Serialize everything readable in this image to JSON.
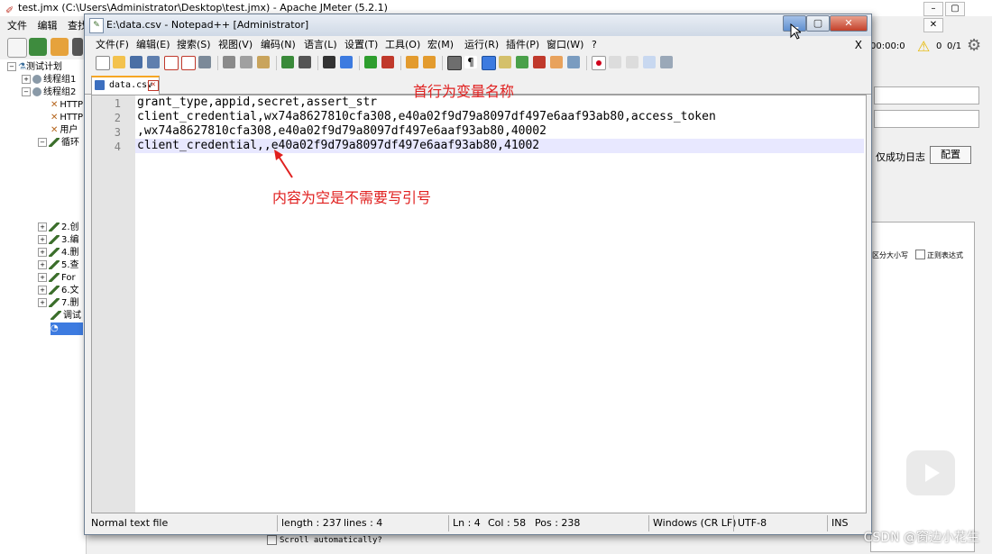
{
  "jmeter": {
    "title": "test.jmx (C:\\Users\\Administrator\\Desktop\\test.jmx) - Apache JMeter (5.2.1)",
    "menu": [
      "文件",
      "编辑",
      "查找"
    ],
    "tree": [
      {
        "label": "测试计划"
      },
      {
        "label": "线程组1"
      },
      {
        "label": "线程组2"
      },
      {
        "label": "HTTP"
      },
      {
        "label": "HTTP"
      },
      {
        "label": "用户"
      },
      {
        "label": "循环"
      },
      {
        "label": "2.创"
      },
      {
        "label": "3.编"
      },
      {
        "label": "4.删"
      },
      {
        "label": "5.查"
      },
      {
        "label": "For"
      },
      {
        "label": "6.文"
      },
      {
        "label": "7.删"
      },
      {
        "label": "调试"
      }
    ],
    "toolbar_right": {
      "time": "00:00:0",
      "warn_count": "0",
      "ratio": "0/1"
    },
    "log_only_success": "仅成功日志",
    "config_button": "配置",
    "case_sensitive": "区分大小写",
    "regex": "正则表达式",
    "scroll_label": "Scroll automatically?"
  },
  "notepad": {
    "title": "E:\\data.csv - Notepad++ [Administrator]",
    "menu": [
      "文件(F)",
      "编辑(E)",
      "搜索(S)",
      "视图(V)",
      "编码(N)",
      "语言(L)",
      "设置(T)",
      "工具(O)",
      "宏(M)",
      "运行(R)",
      "插件(P)",
      "窗口(W)",
      "?"
    ],
    "close_doc": "X",
    "tab": {
      "name": "data.csv"
    },
    "lines": [
      {
        "num": "1",
        "text": "grant_type,appid,secret,assert_str"
      },
      {
        "num": "2",
        "text": "client_credential,wx74a8627810cfa308,e40a02f9d79a8097df497e6aaf93ab80,access_token"
      },
      {
        "num": "3",
        "text": ",wx74a8627810cfa308,e40a02f9d79a8097df497e6aaf93ab80,40002"
      },
      {
        "num": "4",
        "text": "client_credential,,e40a02f9d79a8097df497e6aaf93ab80,41002"
      }
    ],
    "status": {
      "type": "Normal text file",
      "length": "length : 237",
      "lines": "lines : 4",
      "ln": "Ln : 4",
      "col": "Col : 58",
      "pos": "Pos : 238",
      "eol": "Windows (CR LF)",
      "encoding": "UTF-8",
      "mode": "INS"
    }
  },
  "annotations": {
    "header_note": "首行为变量名称",
    "empty_note": "内容为空是不需要写引号"
  },
  "watermark": "CSDN @窗边小花生",
  "colors": {
    "annotation": "#e0201f",
    "current_line": "#e8e8ff"
  }
}
